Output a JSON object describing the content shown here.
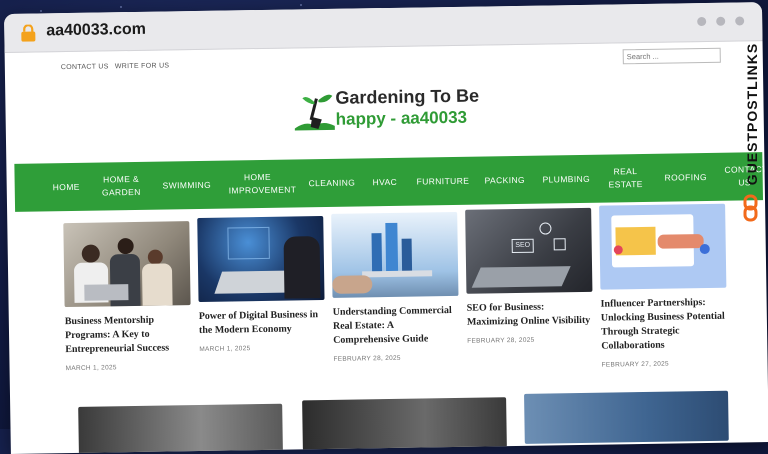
{
  "browser": {
    "url": "aa40033.com"
  },
  "topbar": {
    "links": [
      "CONTACT US",
      "WRITE FOR US"
    ],
    "search_placeholder": "Search ..."
  },
  "logo": {
    "line1": "Gardening To Be",
    "line2": "happy - aa40033"
  },
  "nav": {
    "items": [
      {
        "label": "HOME"
      },
      {
        "label": "HOME & GARDEN"
      },
      {
        "label": "SWIMMING"
      },
      {
        "label": "HOME IMPROVEMENT"
      },
      {
        "label": "CLEANING"
      },
      {
        "label": "HVAC"
      },
      {
        "label": "FURNITURE"
      },
      {
        "label": "PACKING"
      },
      {
        "label": "PLUMBING"
      },
      {
        "label": "REAL ESTATE"
      },
      {
        "label": "ROOFING"
      },
      {
        "label": "CONTACT US"
      }
    ]
  },
  "articles": [
    {
      "title": "Business Mentorship Programs: A Key to Entrepreneurial Success",
      "date": "MARCH 1, 2025"
    },
    {
      "title": "Power of Digital Business in the Modern Economy",
      "date": "MARCH 1, 2025"
    },
    {
      "title": "Understanding Commercial Real Estate: A Comprehensive Guide",
      "date": "FEBRUARY 28, 2025"
    },
    {
      "title": "SEO for Business: Maximizing Online Visibility",
      "date": "FEBRUARY 28, 2025"
    },
    {
      "title": "Influencer Partnerships: Unlocking Business Potential Through Strategic Collaborations",
      "date": "FEBRUARY 27, 2025"
    }
  ],
  "side_brand": {
    "text": "GUESTPOSTLINKS"
  },
  "colors": {
    "nav_green": "#2f9e39",
    "logo_green": "#2f9b35",
    "background": "#121b44",
    "brand_orange": "#f26a1b"
  }
}
